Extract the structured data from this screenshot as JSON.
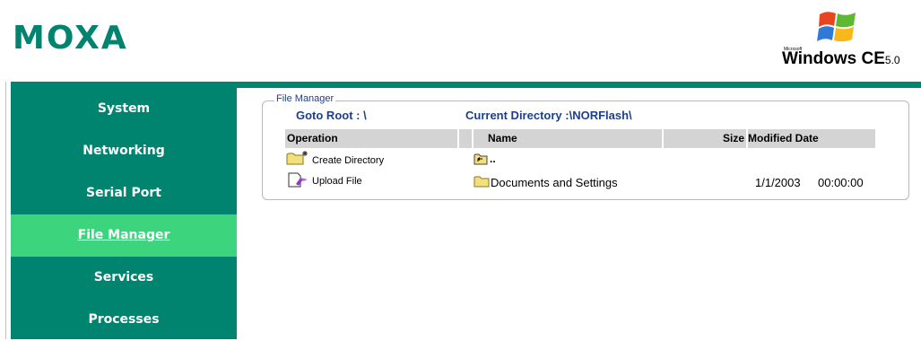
{
  "header": {
    "logo": "MOXA",
    "windows_small": "Microsoft",
    "windows_text": "Windows CE",
    "windows_version": "5.0"
  },
  "sidebar": {
    "items": [
      {
        "label": "System"
      },
      {
        "label": "Networking"
      },
      {
        "label": "Serial Port"
      },
      {
        "label": "File Manager",
        "active": true
      },
      {
        "label": "Services"
      },
      {
        "label": "Processes"
      }
    ]
  },
  "file_manager": {
    "legend": "File Manager",
    "goto_root": "Goto Root : \\",
    "current_directory": "Current Directory :\\NORFlash\\",
    "columns": {
      "operation": "Operation",
      "name": "Name",
      "size": "Size",
      "modified": "Modified Date"
    },
    "operations": [
      {
        "label": "Create Directory",
        "icon": "new-folder-icon"
      },
      {
        "label": "Upload File",
        "icon": "upload-file-icon"
      }
    ],
    "rows": [
      {
        "name": "..",
        "icon": "parent-folder-icon",
        "size": "",
        "date": "",
        "time": ""
      },
      {
        "name": "Documents and Settings",
        "icon": "folder-icon",
        "size": "",
        "date": "1/1/2003",
        "time": "00:00:00"
      }
    ]
  },
  "colors": {
    "brand": "#008470",
    "active": "#3cd47c",
    "link": "#1e3f8a",
    "header_bg": "#d4d4d4"
  }
}
